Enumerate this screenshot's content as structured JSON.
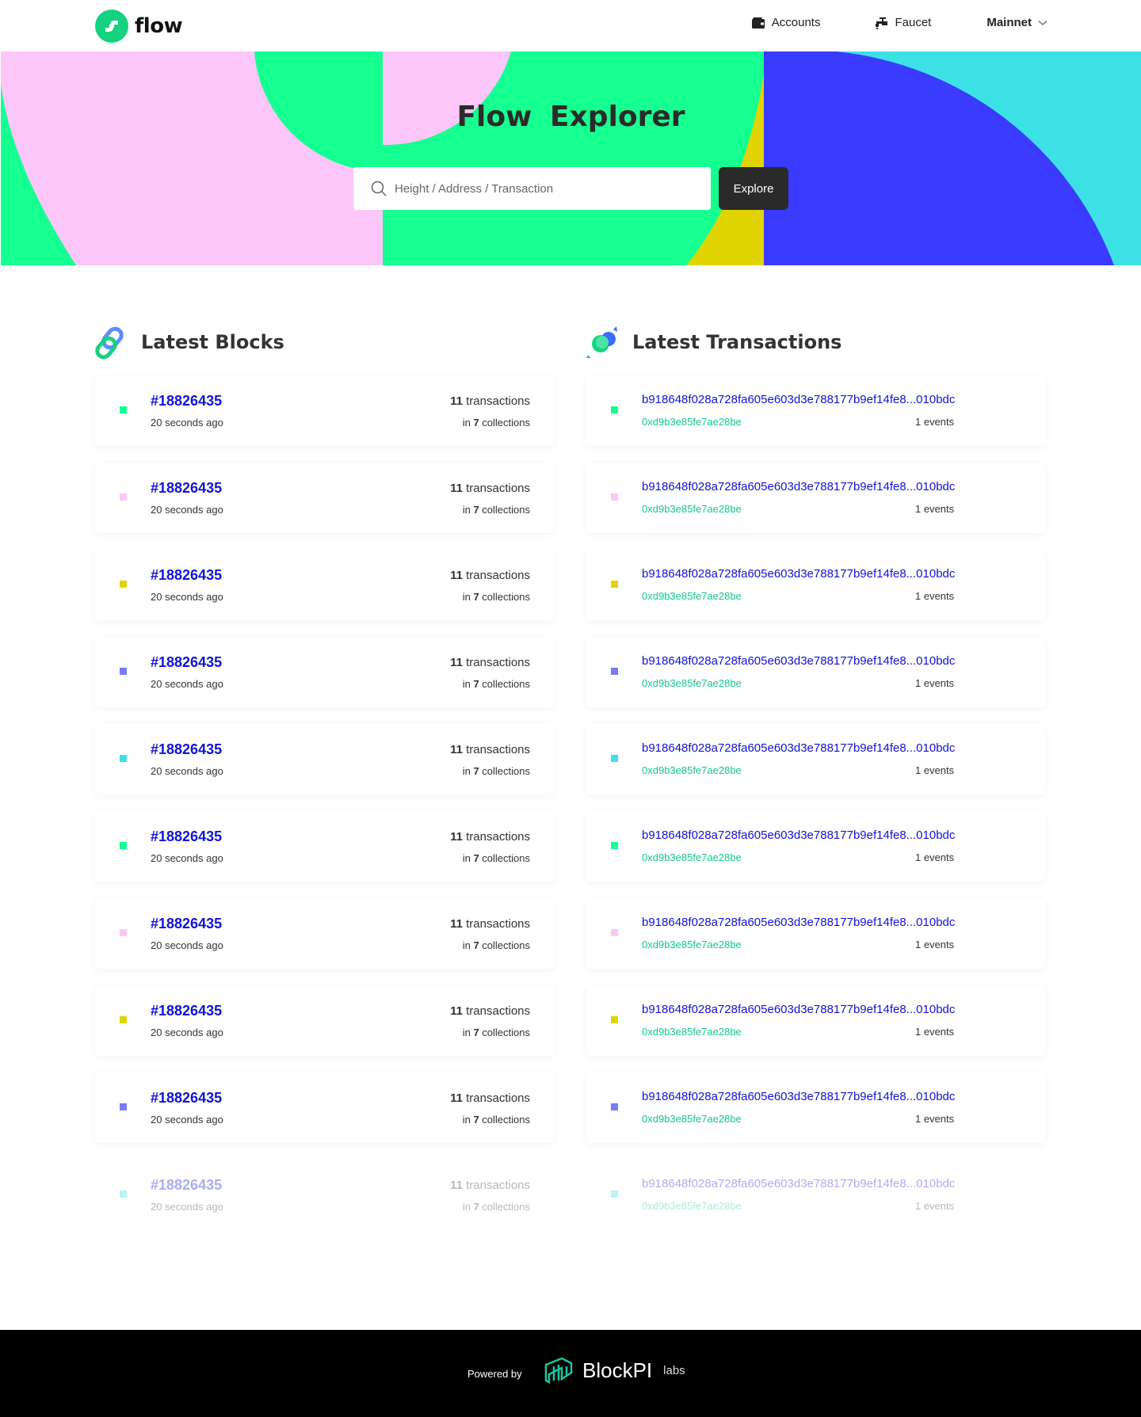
{
  "header": {
    "brand": "flow",
    "nav": {
      "accounts": "Accounts",
      "faucet": "Faucet",
      "network": "Mainnet"
    }
  },
  "hero": {
    "title": "Flow  Explorer",
    "search_placeholder": "Height / Address / Transaction",
    "explore_label": "Explore"
  },
  "blocks": {
    "heading": "Latest Blocks",
    "items": [
      {
        "number": "#18826435",
        "time": "20 seconds ago",
        "tx_count": "11",
        "tx_label": "transactions",
        "col_prefix": "in",
        "col_count": "7",
        "col_label": "collections"
      },
      {
        "number": "#18826435",
        "time": "20 seconds ago",
        "tx_count": "11",
        "tx_label": "transactions",
        "col_prefix": "in",
        "col_count": "7",
        "col_label": "collections"
      },
      {
        "number": "#18826435",
        "time": "20 seconds ago",
        "tx_count": "11",
        "tx_label": "transactions",
        "col_prefix": "in",
        "col_count": "7",
        "col_label": "collections"
      },
      {
        "number": "#18826435",
        "time": "20 seconds ago",
        "tx_count": "11",
        "tx_label": "transactions",
        "col_prefix": "in",
        "col_count": "7",
        "col_label": "collections"
      },
      {
        "number": "#18826435",
        "time": "20 seconds ago",
        "tx_count": "11",
        "tx_label": "transactions",
        "col_prefix": "in",
        "col_count": "7",
        "col_label": "collections"
      },
      {
        "number": "#18826435",
        "time": "20 seconds ago",
        "tx_count": "11",
        "tx_label": "transactions",
        "col_prefix": "in",
        "col_count": "7",
        "col_label": "collections"
      },
      {
        "number": "#18826435",
        "time": "20 seconds ago",
        "tx_count": "11",
        "tx_label": "transactions",
        "col_prefix": "in",
        "col_count": "7",
        "col_label": "collections"
      },
      {
        "number": "#18826435",
        "time": "20 seconds ago",
        "tx_count": "11",
        "tx_label": "transactions",
        "col_prefix": "in",
        "col_count": "7",
        "col_label": "collections"
      },
      {
        "number": "#18826435",
        "time": "20 seconds ago",
        "tx_count": "11",
        "tx_label": "transactions",
        "col_prefix": "in",
        "col_count": "7",
        "col_label": "collections"
      },
      {
        "number": "#18826435",
        "time": "20 seconds ago",
        "tx_count": "11",
        "tx_label": "transactions",
        "col_prefix": "in",
        "col_count": "7",
        "col_label": "collections"
      }
    ]
  },
  "transactions": {
    "heading": "Latest Transactions",
    "items": [
      {
        "hash": "b918648f028a728fa605e603d3e788177b9ef14fe8...010bdc",
        "address": "0xd9b3e85fe7ae28be",
        "events": "1 events"
      },
      {
        "hash": "b918648f028a728fa605e603d3e788177b9ef14fe8...010bdc",
        "address": "0xd9b3e85fe7ae28be",
        "events": "1 events"
      },
      {
        "hash": "b918648f028a728fa605e603d3e788177b9ef14fe8...010bdc",
        "address": "0xd9b3e85fe7ae28be",
        "events": "1 events"
      },
      {
        "hash": "b918648f028a728fa605e603d3e788177b9ef14fe8...010bdc",
        "address": "0xd9b3e85fe7ae28be",
        "events": "1 events"
      },
      {
        "hash": "b918648f028a728fa605e603d3e788177b9ef14fe8...010bdc",
        "address": "0xd9b3e85fe7ae28be",
        "events": "1 events"
      },
      {
        "hash": "b918648f028a728fa605e603d3e788177b9ef14fe8...010bdc",
        "address": "0xd9b3e85fe7ae28be",
        "events": "1 events"
      },
      {
        "hash": "b918648f028a728fa605e603d3e788177b9ef14fe8...010bdc",
        "address": "0xd9b3e85fe7ae28be",
        "events": "1 events"
      },
      {
        "hash": "b918648f028a728fa605e603d3e788177b9ef14fe8...010bdc",
        "address": "0xd9b3e85fe7ae28be",
        "events": "1 events"
      },
      {
        "hash": "b918648f028a728fa605e603d3e788177b9ef14fe8...010bdc",
        "address": "0xd9b3e85fe7ae28be",
        "events": "1 events"
      },
      {
        "hash": "b918648f028a728fa605e603d3e788177b9ef14fe8...010bdc",
        "address": "0xd9b3e85fe7ae28be",
        "events": "1 events"
      }
    ]
  },
  "dot_colors": [
    "#16ff91",
    "#fdc6f9",
    "#e0d500",
    "#7b7bf5",
    "#3ce1e6"
  ],
  "colors": {
    "link_blue": "#1212d9",
    "address_green": "#12c987",
    "hero_green": "#16ff91",
    "hero_pink": "#fdc6f9",
    "hero_blue": "#3b3bff",
    "hero_cyan": "#3ce1e6",
    "hero_yellow": "#e0d500"
  },
  "footer": {
    "powered_by": "Powered by",
    "brand": "BlockPI",
    "brand_suffix": "labs"
  }
}
